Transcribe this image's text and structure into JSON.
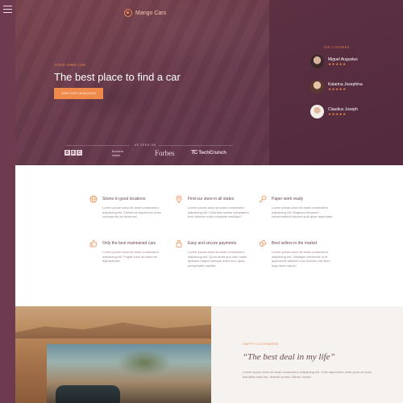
{
  "brand": {
    "name": "Mango Cars"
  },
  "hero": {
    "eyebrow": "YOUR OWN CAR",
    "title": "The best place to find a car",
    "cta": "VIEW OUR CATALOGUE",
    "featured_label": "AS SEEN ON",
    "logos": {
      "bbc": [
        "B",
        "B",
        "C"
      ],
      "business_insider": "Business Insider",
      "forbes": "Forbes",
      "techcrunch_mark": "TC",
      "techcrunch_text": "TechCrunch"
    }
  },
  "reviews": {
    "label": "TOP 3 STORES",
    "items": [
      {
        "name": "Miguel Augustus",
        "stars": "★★★★★"
      },
      {
        "name": "Katarina Josephina",
        "stars": "★★★★★"
      },
      {
        "name": "Claudius Joseph",
        "stars": "★★★★★"
      }
    ]
  },
  "features": [
    {
      "icon": "globe-icon",
      "title": "Stores in good locations",
      "body": "Lorem ipsum dolor sit amet consectetur adipiscing elit. Eleiserum asperiorer dolor cumque illo ab ducimus!"
    },
    {
      "icon": "map-pin-icon",
      "title": "Find our store in all states",
      "body": "Lorem ipsum dolor sit amet consectetur adipiscing elit. Eoloresm saepe voluptatem eos dolorem nulla voluptate similique!"
    },
    {
      "icon": "key-icon",
      "title": "Paper work ready",
      "body": "Lorem ipsum dolor sit amet consectetur adipiscing elit. Magnam temporer reprehenderit dolores quid quae asperiatur."
    },
    {
      "icon": "thumbs-up-icon",
      "title": "Only the best maintained cars",
      "body": "Lorem ipsum dolor sit amet consectetur adipiscing elit. Fugiat iusto ad laborum dignissimos!"
    },
    {
      "icon": "lock-icon",
      "title": "Easy and secure payments",
      "body": "Lorem ipsum dolor sit amet consectetur adipiscing elit. Quod amet quo odio nobis aperiam eaque cumque dolor sed, quas perspiciatis repellat."
    },
    {
      "icon": "tag-icon",
      "title": "Best sellers in the market",
      "body": "Lorem ipsum dolor sit amet consectetur adipiscing elit. Similique reiciendis ut et asperiores adipisci eum dolores nisi illum fuga dolor natus?"
    }
  ],
  "quote": {
    "label": "HAPPY CUSTOMERS",
    "text": "“The best deal in my life”",
    "body": "Lorem ipsum dolor sit amet consectetur adipiscing elit. Odio asperiores nulla quod vel ipsa blanditiis laborum, deleniti omnis! Officiis, totam!"
  },
  "colors": {
    "accent": "#f08a4b",
    "hero_bg": "#6a3c4e",
    "rail": "#6e3a50"
  }
}
